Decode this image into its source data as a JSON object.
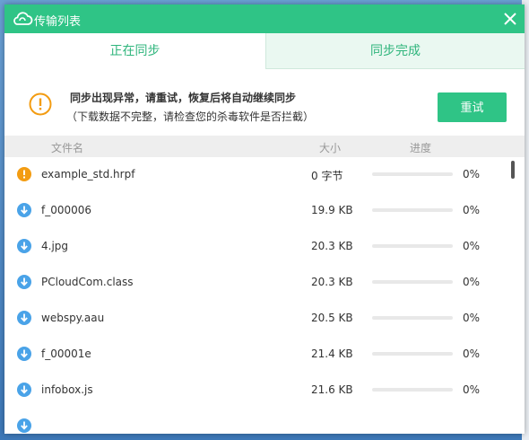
{
  "window": {
    "title": "传输列表"
  },
  "tabs": [
    {
      "label": "正在同步",
      "active": true
    },
    {
      "label": "同步完成",
      "active": false
    }
  ],
  "alert": {
    "message": "同步出现异常，请重试，恢复后将自动继续同步",
    "detail": "（下载数据不完整，请检查您的杀毒软件是否拦截）",
    "retry_label": "重试"
  },
  "columns": {
    "name": "文件名",
    "size": "大小",
    "progress": "进度"
  },
  "files": [
    {
      "icon": "warning-icon",
      "name": "example_std.hrpf",
      "size": "0 字节",
      "progress": "0%"
    },
    {
      "icon": "download-icon",
      "name": "f_000006",
      "size": "19.9 KB",
      "progress": "0%"
    },
    {
      "icon": "download-icon",
      "name": "4.jpg",
      "size": "20.3 KB",
      "progress": "0%"
    },
    {
      "icon": "download-icon",
      "name": "PCloudCom.class",
      "size": "20.3 KB",
      "progress": "0%"
    },
    {
      "icon": "download-icon",
      "name": "webspy.aau",
      "size": "20.5 KB",
      "progress": "0%"
    },
    {
      "icon": "download-icon",
      "name": "f_00001e",
      "size": "21.4 KB",
      "progress": "0%"
    },
    {
      "icon": "download-icon",
      "name": "infobox.js",
      "size": "21.6 KB",
      "progress": "0%"
    }
  ],
  "colors": {
    "accent": "#2fc486",
    "warning": "#f39c12",
    "download": "#4aa3e8"
  }
}
